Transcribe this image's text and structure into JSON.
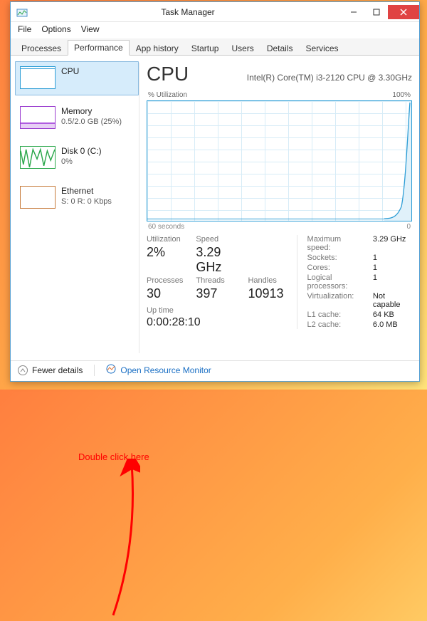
{
  "window": {
    "title": "Task Manager"
  },
  "menu": {
    "file": "File",
    "options": "Options",
    "view": "View"
  },
  "tabs": {
    "processes": "Processes",
    "performance": "Performance",
    "appHistory": "App history",
    "startup": "Startup",
    "users": "Users",
    "details": "Details",
    "services": "Services"
  },
  "side": {
    "cpu": {
      "title": "CPU",
      "sub": ""
    },
    "memory": {
      "title": "Memory",
      "sub": "0.5/2.0 GB (25%)"
    },
    "disk": {
      "title": "Disk 0 (C:)",
      "sub": "0%"
    },
    "eth": {
      "title": "Ethernet",
      "sub": "S: 0 R: 0 Kbps"
    }
  },
  "main": {
    "heading": "CPU",
    "subheading": "Intel(R) Core(TM) i3-2120 CPU @ 3.30GHz",
    "chartTop": {
      "left": "% Utilization",
      "right": "100%"
    },
    "chartBottom": {
      "left": "60 seconds",
      "right": "0"
    },
    "stats": {
      "utilizationLabel": "Utilization",
      "utilization": "2%",
      "speedLabel": "Speed",
      "speed": "3.29 GHz",
      "processesLabel": "Processes",
      "processes": "30",
      "threadsLabel": "Threads",
      "threads": "397",
      "handlesLabel": "Handles",
      "handles": "10913",
      "uptimeLabel": "Up time",
      "uptime": "0:00:28:10"
    },
    "right": {
      "maxSpeedLabel": "Maximum speed:",
      "maxSpeed": "3.29 GHz",
      "socketsLabel": "Sockets:",
      "sockets": "1",
      "coresLabel": "Cores:",
      "cores": "1",
      "lpLabel": "Logical processors:",
      "lp": "1",
      "virtLabel": "Virtualization:",
      "virt": "Not capable",
      "l1Label": "L1 cache:",
      "l1": "64 KB",
      "l2Label": "L2 cache:",
      "l2": "6.0 MB"
    }
  },
  "footer": {
    "fewer": "Fewer details",
    "orm": "Open Resource Monitor"
  },
  "annotation": {
    "text": "Double click here"
  },
  "chart_data": {
    "type": "line",
    "title": "% Utilization",
    "xlabel": "seconds",
    "ylabel": "Utilization %",
    "x_range": [
      60,
      0
    ],
    "ylim": [
      0,
      100
    ],
    "x": [
      60,
      55,
      50,
      45,
      40,
      35,
      30,
      25,
      20,
      15,
      10,
      8,
      6,
      4,
      2,
      0
    ],
    "values": [
      2,
      2,
      2,
      2,
      2,
      2,
      2,
      2,
      2,
      2,
      2,
      4,
      10,
      30,
      70,
      100
    ]
  }
}
